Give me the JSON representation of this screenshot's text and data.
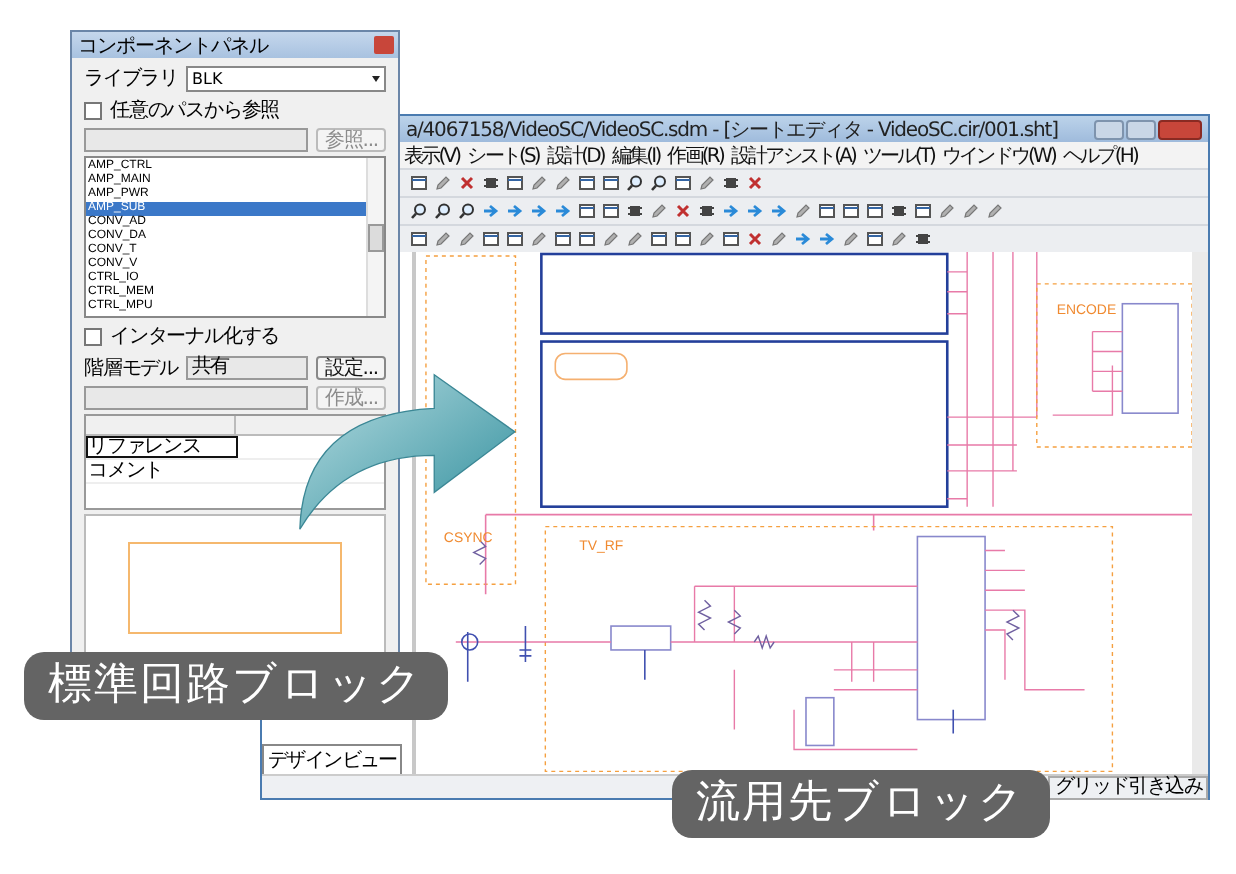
{
  "component_panel": {
    "title": "コンポーネントパネル",
    "library_label": "ライブラリ",
    "library_value": "BLK",
    "path_checkbox": {
      "label": "任意のパスから参照",
      "checked": false
    },
    "browse_button": {
      "label": "参照...",
      "disabled": true
    },
    "components": [
      {
        "label": "AMP_CTRL",
        "selected": false
      },
      {
        "label": "AMP_MAIN",
        "selected": false
      },
      {
        "label": "AMP_PWR",
        "selected": false
      },
      {
        "label": "AMP_SUB",
        "selected": true
      },
      {
        "label": "CONV_AD",
        "selected": false
      },
      {
        "label": "CONV_DA",
        "selected": false
      },
      {
        "label": "CONV_T",
        "selected": false
      },
      {
        "label": "CONV_V",
        "selected": false
      },
      {
        "label": "CTRL_IO",
        "selected": false
      },
      {
        "label": "CTRL_MEM",
        "selected": false
      },
      {
        "label": "CTRL_MPU",
        "selected": false
      }
    ],
    "internal_checkbox": {
      "label": "インターナル化する",
      "checked": false
    },
    "model_label": "階層モデル",
    "model_value": "共有",
    "settings_button": {
      "label": "設定...",
      "disabled": false
    },
    "create_button": {
      "label": "作成...",
      "disabled": true
    },
    "properties": [
      {
        "name": "リファレンス",
        "selected": true
      },
      {
        "name": "コメント",
        "selected": false
      }
    ]
  },
  "main_window": {
    "title": "a/4067158/VideoSC/VideoSC.sdm - [シートエディタ - VideoSC.cir/001.sht]",
    "menu": [
      "表示(V)",
      "シート(S)",
      "設計(D)",
      "編集(I)",
      "作画(R)",
      "設計アシスト(A)",
      "ツール(T)",
      "ウインドウ(W)",
      "ヘルプ(H)"
    ],
    "blocks": [
      {
        "label": "ENCODE"
      },
      {
        "label": "CSYNC"
      },
      {
        "label": "TV_RF"
      }
    ],
    "left_tab": "デザインビュー",
    "status": "グリッド引き込み"
  },
  "callouts": [
    "標準回路ブロック",
    "流用先ブロック"
  ]
}
